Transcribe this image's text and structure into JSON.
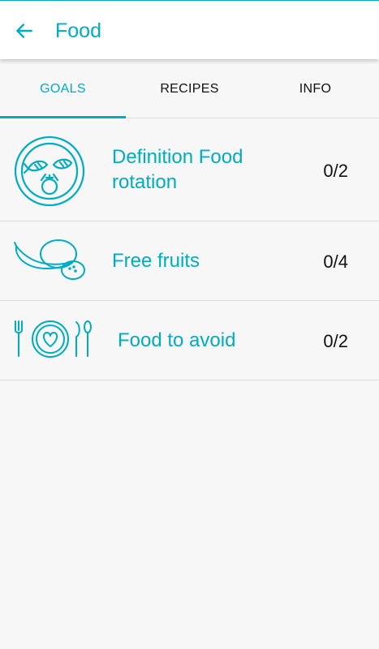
{
  "header": {
    "back_icon": "arrow-left-icon",
    "title": "Food",
    "accent_color": "#00acc1"
  },
  "tabs": [
    {
      "label": "GOALS",
      "active": true
    },
    {
      "label": "RECIPES",
      "active": false
    },
    {
      "label": "INFO",
      "active": false
    }
  ],
  "goals": [
    {
      "label": "Definition Food rotation",
      "count": "0/2",
      "icon": "plate-food-icon"
    },
    {
      "label": "Free fruits",
      "count": "0/4",
      "icon": "fruits-icon"
    },
    {
      "label": "Food to avoid",
      "count": "0/2",
      "icon": "cutlery-heart-icon"
    }
  ]
}
